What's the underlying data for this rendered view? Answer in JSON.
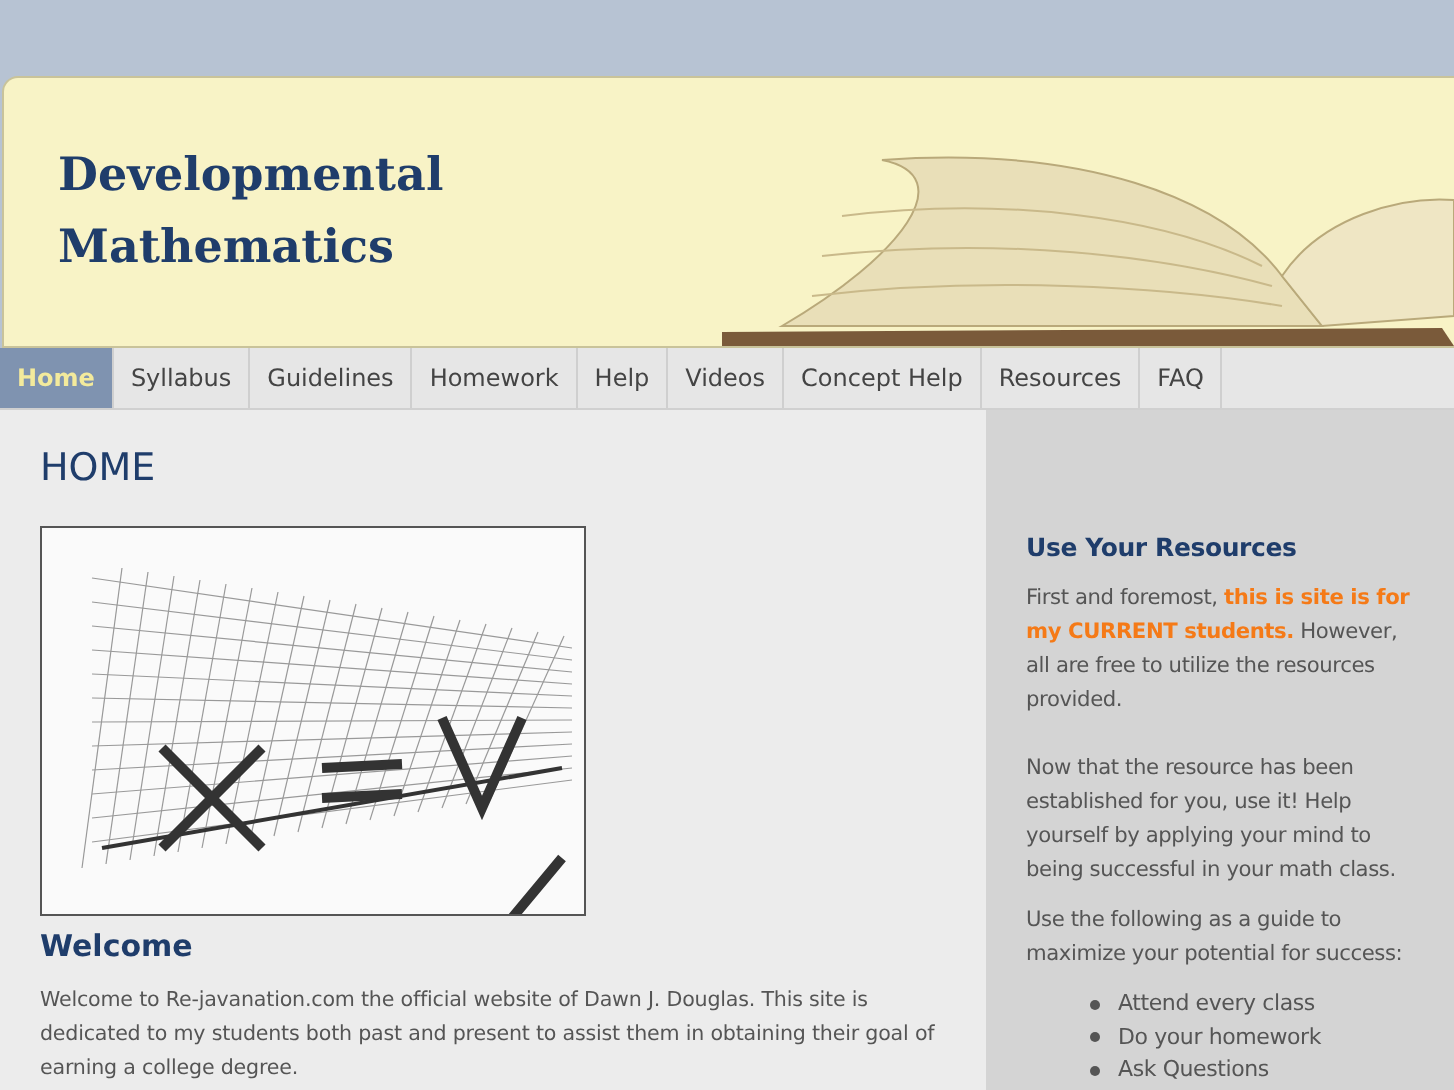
{
  "header": {
    "title_lines": [
      "Developmental",
      "Mathematics"
    ]
  },
  "nav": [
    {
      "label": "Home",
      "selected": true
    },
    {
      "label": "Syllabus",
      "selected": false
    },
    {
      "label": "Guidelines",
      "selected": false
    },
    {
      "label": "Homework",
      "selected": false
    },
    {
      "label": "Help",
      "selected": false
    },
    {
      "label": "Videos",
      "selected": false
    },
    {
      "label": "Concept Help",
      "selected": false
    },
    {
      "label": "Resources",
      "selected": false
    },
    {
      "label": "FAQ",
      "selected": false
    }
  ],
  "main": {
    "page_title": "HOME",
    "heading": "Welcome",
    "paragraph": "Welcome to Re-javanation.com the official website of Dawn J. Douglas. This site is dedicated to my students both past and present to assist them in obtaining their goal of earning a college degree."
  },
  "sidebar": {
    "heading": "Use Your Resources",
    "paragraphs": [
      "First and foremost, **this is site is for my CURRENT students.**  However, all are free to utilize the resources provided.",
      "Now that the resource has been established for you, use it! Help yourself by applying your mind to being successful in your math class.",
      "Use the following as a guide to maximize your potential for success:"
    ],
    "list": [
      "Attend every class",
      "Do your homework",
      "Ask Questions"
    ]
  }
}
